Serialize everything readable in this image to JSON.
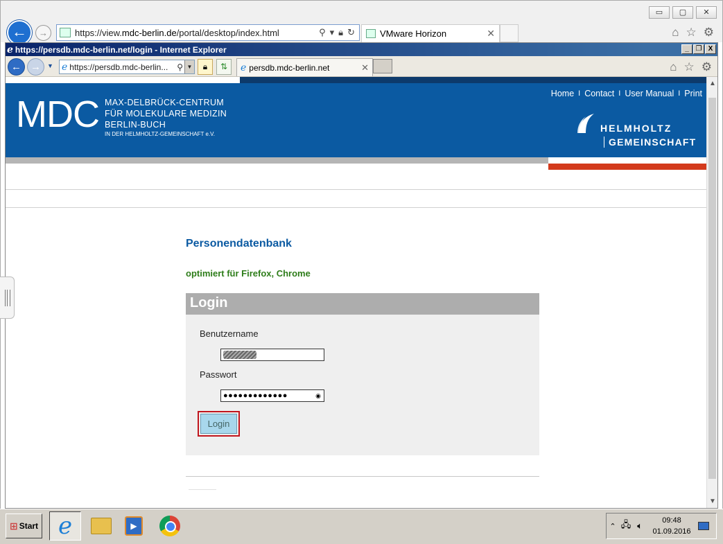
{
  "outer_browser": {
    "url_prefix": "https://view.",
    "url_domain": "mdc-berlin.de",
    "url_path": "/portal/desktop/index.html",
    "tab_title": "VMware Horizon",
    "tab_close": "✕",
    "window_buttons": {
      "minimize": "▭",
      "maximize": "▢",
      "close": "✕"
    }
  },
  "inner_browser": {
    "title": "https://persdb.mdc-berlin.net/login - Internet Explorer",
    "url": "https://persdb.mdc-berlin...",
    "tab_title": "persdb.mdc-berlin.net",
    "tab_close": "✕",
    "title_buttons": {
      "minimize": "_",
      "restore": "❐",
      "close": "X"
    }
  },
  "header": {
    "logo": "MDC",
    "subtitle_lines": [
      "MAX-DELBRÜCK-CENTRUM",
      "FÜR MOLEKULARE MEDIZIN",
      "BERLIN-BUCH"
    ],
    "subtitle_small": "IN DER HELMHOLTZ-GEMEINSCHAFT e.V.",
    "nav": [
      "Home",
      "Contact",
      "User Manual",
      "Print"
    ],
    "nav_separator": "I",
    "partner_line1": "HELMHOLTZ",
    "partner_line2": "GEMEINSCHAFT"
  },
  "main": {
    "heading": "Personendatenbank",
    "subheading": "optimiert für Firefox, Chrome",
    "login_title": "Login",
    "username_label": "Benutzername",
    "password_label": "Passwort",
    "password_mask": "●●●●●●●●●●●●●",
    "login_button": "Login"
  },
  "taskbar": {
    "start_label": "Start",
    "time": "09:48",
    "date": "01.09.2016"
  },
  "colors": {
    "brand_blue": "#0b5aa2",
    "accent_red": "#d33a1c",
    "green_text": "#2e7d1a",
    "login_header_grey": "#adadad"
  }
}
